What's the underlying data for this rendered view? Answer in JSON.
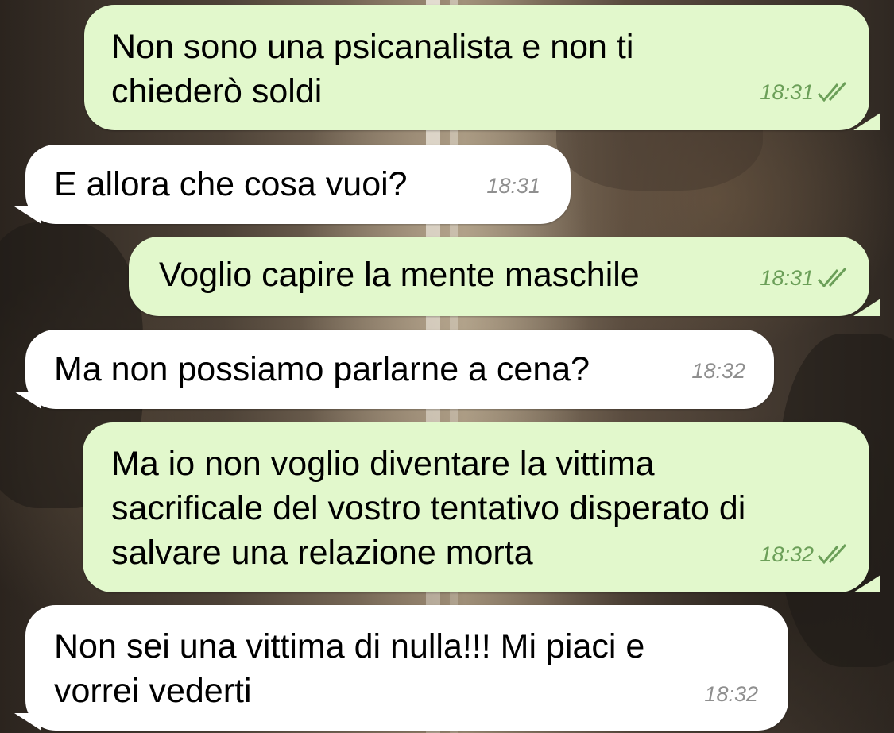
{
  "chat": {
    "messages": [
      {
        "direction": "outgoing",
        "text": "Non sono una psicanalista e non ti\nchiederò soldi",
        "time": "18:31",
        "status_icon": "double-check-read-icon"
      },
      {
        "direction": "incoming",
        "text": "E allora che cosa vuoi?",
        "time": "18:31"
      },
      {
        "direction": "outgoing",
        "text": "Voglio capire la mente maschile",
        "time": "18:31",
        "status_icon": "double-check-read-icon"
      },
      {
        "direction": "incoming",
        "text": "Ma non possiamo parlarne a cena?",
        "time": "18:32"
      },
      {
        "direction": "outgoing",
        "text": "Ma io non voglio diventare la vittima\nsacrificale del vostro tentativo disperato di\nsalvare una relazione morta",
        "time": "18:32",
        "status_icon": "double-check-read-icon"
      },
      {
        "direction": "incoming",
        "text": "Non sei una vittima di nulla!!! Mi piaci e\nvorrei vederti",
        "time": "18:32"
      }
    ]
  },
  "colors": {
    "outgoing_bubble": "#e2f8cc",
    "incoming_bubble": "#ffffff",
    "outgoing_meta": "#6b9f58",
    "incoming_meta": "#8f8f8f"
  }
}
